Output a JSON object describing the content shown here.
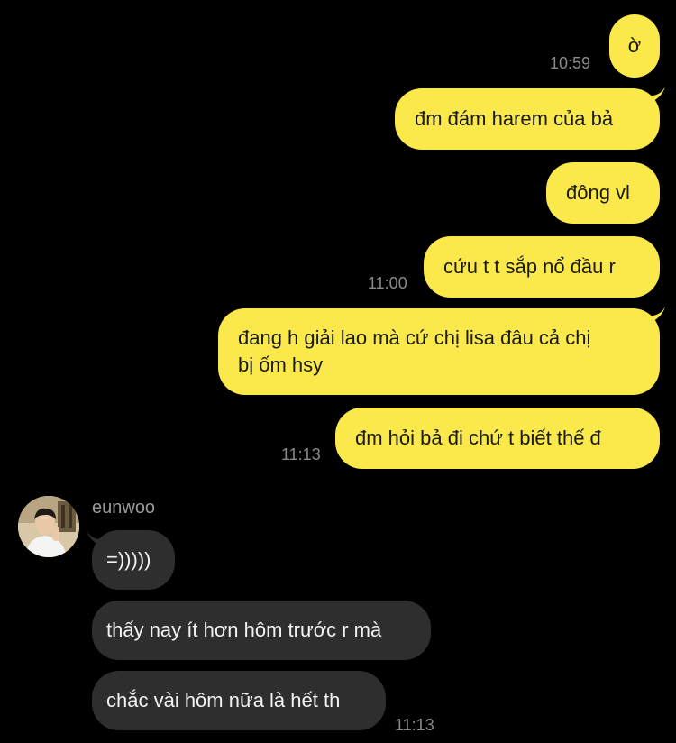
{
  "colors": {
    "background": "#000000",
    "outgoing_bubble": "#fbe84a",
    "incoming_bubble": "#2e2e2e",
    "timestamp": "#8a8a8a"
  },
  "messages_out": [
    {
      "text": "ờ",
      "time": "10:59"
    },
    {
      "text": "đm đám harem của bả",
      "time": ""
    },
    {
      "text": "đông vl",
      "time": ""
    },
    {
      "text": "cứu t t sắp nổ đầu r",
      "time": "11:00"
    },
    {
      "text": "đang h giải lao mà cứ chị lisa đâu cả chị bị ốm hsy",
      "line1": "đang h giải lao mà cứ chị lisa đâu cả chị",
      "line2": "bị ốm hsy",
      "time": ""
    },
    {
      "text": "đm hỏi bả đi chứ t biết thế đ",
      "time": "11:13"
    }
  ],
  "sender": {
    "name": "eunwoo",
    "avatar_icon": "profile-photo"
  },
  "messages_in": [
    {
      "text": "=)))))",
      "time": ""
    },
    {
      "text": "thấy nay ít hơn hôm trước r mà",
      "time": ""
    },
    {
      "text": "chắc vài hôm nữa là hết th",
      "time": "11:13"
    }
  ]
}
